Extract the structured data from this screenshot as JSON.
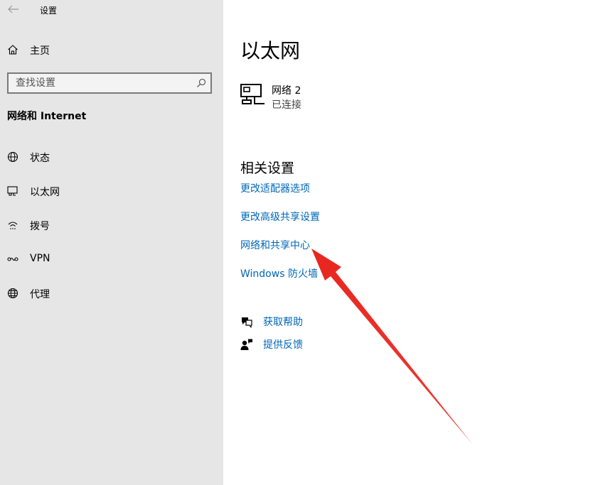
{
  "window": {
    "title": "设置"
  },
  "sidebar": {
    "home_label": "主页",
    "search_placeholder": "查找设置",
    "section_heading": "网络和 Internet",
    "items": [
      {
        "label": "状态",
        "icon": "status-globe-icon"
      },
      {
        "label": "以太网",
        "icon": "ethernet-icon"
      },
      {
        "label": "拨号",
        "icon": "dialup-icon"
      },
      {
        "label": "VPN",
        "icon": "vpn-icon"
      },
      {
        "label": "代理",
        "icon": "proxy-globe-icon"
      }
    ]
  },
  "main": {
    "title": "以太网",
    "network": {
      "name": "网络 2",
      "status": "已连接",
      "icon": "network-monitor-icon"
    },
    "related_heading": "相关设置",
    "links": [
      "更改适配器选项",
      "更改高级共享设置",
      "网络和共享中心",
      "Windows 防火墙"
    ],
    "help": [
      {
        "label": "获取帮助",
        "icon": "get-help-icon"
      },
      {
        "label": "提供反馈",
        "icon": "feedback-icon"
      }
    ]
  },
  "colors": {
    "sidebar_bg": "#e6e6e6",
    "link": "#0067b8",
    "annotation_arrow": "#e8261e"
  }
}
